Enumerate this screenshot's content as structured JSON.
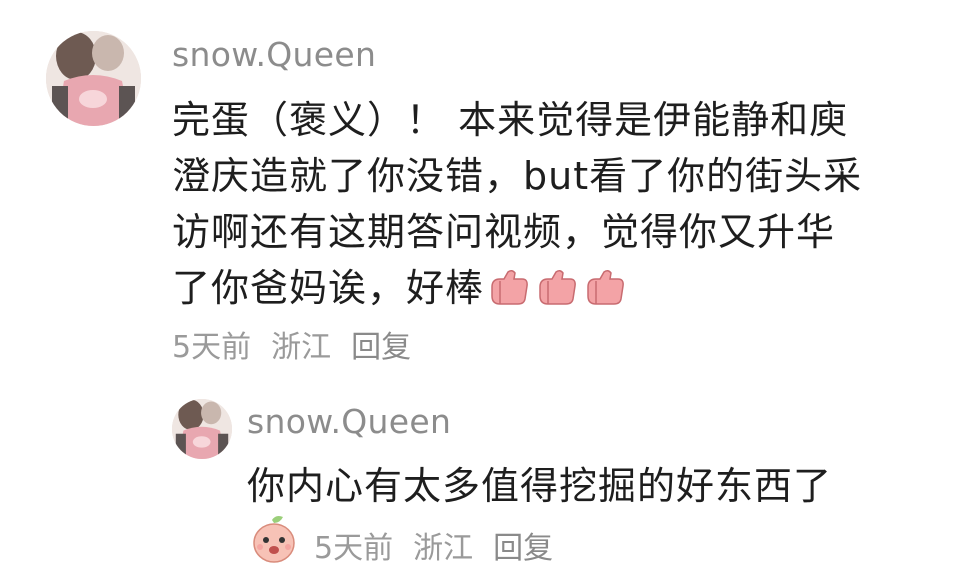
{
  "comment": {
    "username": "snow.Queen",
    "lines": [
      "完蛋（褒义）！ 本来觉得是伊能静和庾",
      "澄庆造就了你没错，but看了你的街头采",
      "访啊还有这期答问视频，觉得你又升华",
      "了你爸妈诶，好棒"
    ],
    "emoji_names": [
      "thumbs-up-icon",
      "thumbs-up-icon",
      "thumbs-up-icon"
    ],
    "time": "5天前",
    "location": "浙江",
    "reply_label": "回复"
  },
  "reply": {
    "username": "snow.Queen",
    "text": "你内心有太多值得挖掘的好东西了",
    "sticker_name": "peach-sticker-icon",
    "time": "5天前",
    "location": "浙江",
    "reply_label": "回复"
  },
  "colors": {
    "username": "#8c8c8c",
    "text": "#1e1e1e",
    "meta": "#9a9a9a",
    "thumb": "#f0a0a0"
  }
}
